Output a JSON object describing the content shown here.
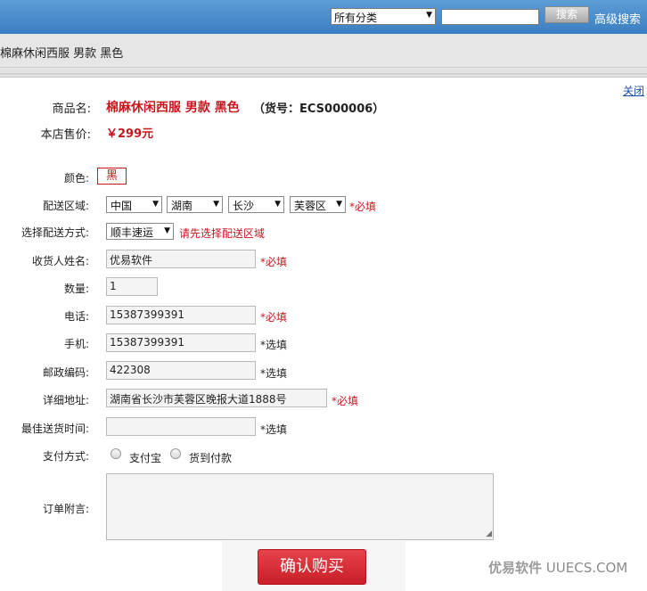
{
  "header": {
    "category_select": "所有分类",
    "search_placeholder": "",
    "search_button": "搜索",
    "advanced_search": "高级搜索"
  },
  "breadcrumb": "棉麻休闲西服 男款 黑色",
  "dialog": {
    "close_label": "关闭",
    "product_name_label": "商品名:",
    "product_name": "棉麻休闲西服 男款 黑色",
    "product_sku": "（货号：ECS000006）",
    "price_label": "本店售价:",
    "price": "￥299元"
  },
  "form": {
    "color_label": "颜色:",
    "color_value": "黑",
    "region_label": "配送区域:",
    "region": {
      "country": "中国",
      "province": "湖南",
      "city": "长沙",
      "district": "芙蓉区"
    },
    "required_mark": "*必填",
    "optional_mark": "*选填",
    "shipping_label": "选择配送方式:",
    "shipping_value": "顺丰速运",
    "shipping_warning": "请先选择配送区域",
    "receiver_label": "收货人姓名:",
    "receiver_value": "优易软件",
    "quantity_label": "数量:",
    "quantity_value": "1",
    "phone_label": "电话:",
    "phone_value": "15387399391",
    "mobile_label": "手机:",
    "mobile_value": "15387399391",
    "zip_label": "邮政编码:",
    "zip_value": "422308",
    "address_label": "详细地址:",
    "address_value": "湖南省长沙市芙蓉区晚报大道1888号",
    "delivery_time_label": "最佳送货时间:",
    "delivery_time_value": "",
    "payment_label": "支付方式:",
    "payment_options": [
      "支付宝",
      "货到付款"
    ],
    "note_label": "订单附言:",
    "submit_label": "确认购买"
  },
  "watermark": {
    "cn": "优易软件",
    "en": "UUECS.COM"
  },
  "colors": {
    "accent_red": "#c8161d",
    "header_blue": "#3a7fc4"
  }
}
